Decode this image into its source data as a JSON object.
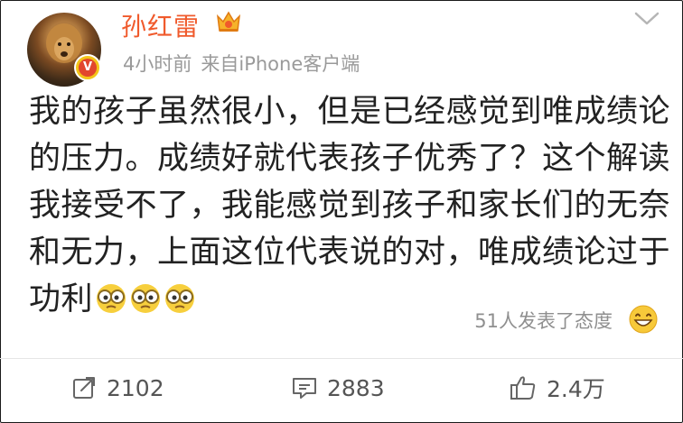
{
  "post": {
    "author_name": "孙红雷",
    "time": "4小时前",
    "source": "来自iPhone客户端",
    "verified_badge": "V",
    "content_lines": [
      "我的孩子虽然很小，但是已经感觉到唯成绩论",
      "的压力。成绩好就代表孩子优秀了？这个解读",
      "我接受不了，我能感觉到孩子和家长们的无奈",
      "和无力，上面这位代表说的对，唯成绩论过于",
      "功利"
    ],
    "emoji_icons": [
      "goggles-emoji-icon",
      "goggles-emoji-icon",
      "goggles-emoji-icon"
    ],
    "reactions_text": "51人发表了态度"
  },
  "actions": {
    "repost_count": "2102",
    "comment_count": "2883",
    "like_count": "2.4万"
  },
  "colors": {
    "name": "#f05a2c",
    "meta": "#9a9a9a",
    "text": "#222222",
    "badge_yellow": "#f3c419"
  }
}
